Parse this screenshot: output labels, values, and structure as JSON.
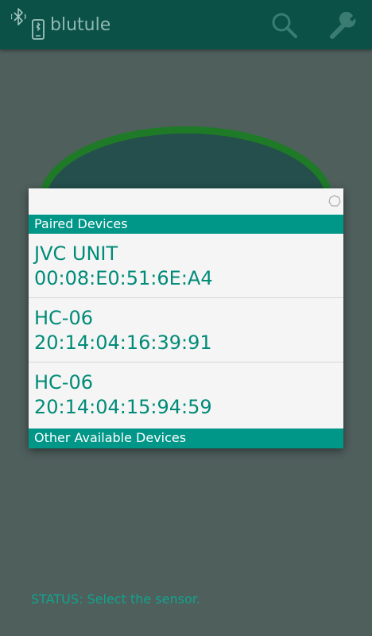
{
  "app": {
    "title": "blutule",
    "icons": {
      "app": "bluetooth-phone-icon",
      "search": "search-icon",
      "settings": "wrench-icon"
    }
  },
  "dialog": {
    "progress_icon": "progress-spinner-icon",
    "paired_header": "Paired Devices",
    "paired_devices": [
      {
        "name": "JVC UNIT",
        "address": "00:08:E0:51:6E:A4"
      },
      {
        "name": "HC-06",
        "address": "20:14:04:16:39:91"
      },
      {
        "name": "HC-06",
        "address": "20:14:04:15:94:59"
      }
    ],
    "other_header": "Other Available Devices"
  },
  "status": {
    "text": "STATUS: Select the sensor."
  },
  "colors": {
    "app_bar": "#0b5147",
    "background": "#4f5f5c",
    "accent": "#009688",
    "gauge_ring": "#1f7a28",
    "gauge_fill": "#244f4c",
    "device_text": "#008b78"
  }
}
